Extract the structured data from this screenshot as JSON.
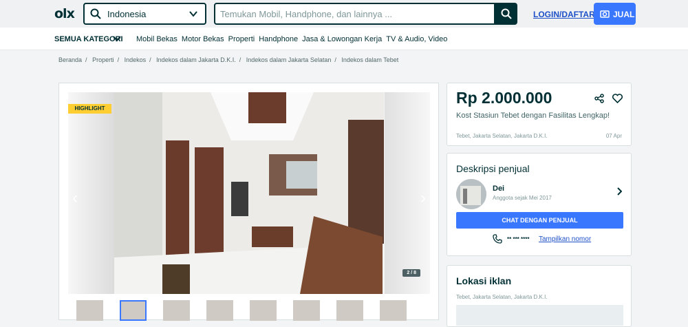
{
  "header": {
    "logo": "olx",
    "location_value": "Indonesia",
    "search_placeholder": "Temukan Mobil, Handphone, dan lainnya ...",
    "login_label": "LOGIN/DAFTAR",
    "sell_label": "JUAL"
  },
  "categories": {
    "all_label": "SEMUA KATEGORI",
    "items": [
      "Mobil Bekas",
      "Motor Bekas",
      "Properti",
      "Handphone",
      "Jasa & Lowongan Kerja",
      "TV & Audio, Video"
    ]
  },
  "breadcrumb": [
    "Beranda",
    "Properti",
    "Indekos",
    "Indekos dalam Jakarta D.K.I.",
    "Indekos dalam Jakarta Selatan",
    "Indekos dalam Tebet"
  ],
  "gallery": {
    "badge": "HIGHLIGHT",
    "counter": "2 / 8",
    "thumb_count": 8,
    "active_thumb": 2
  },
  "listing": {
    "price": "Rp 2.000.000",
    "title": "Kost Stasiun Tebet dengan Fasilitas Lengkap!",
    "location": "Tebet, Jakarta Selatan, Jakarta D.K.I.",
    "date": "07 Apr"
  },
  "seller": {
    "heading": "Deskripsi penjual",
    "name": "Dei",
    "member_since": "Anggota sejak Mei 2017",
    "chat_label": "CHAT DENGAN PENJUAL",
    "phone_masked": "** *** ****",
    "show_number": "Tampilkan nomor"
  },
  "ad_location": {
    "heading": "Lokasi iklan",
    "location": "Tebet, Jakarta Selatan, Jakarta D.K.I."
  },
  "colors": {
    "brand_dark": "#002f34",
    "accent_blue": "#3a77ff",
    "badge_yellow": "#ffce32"
  }
}
